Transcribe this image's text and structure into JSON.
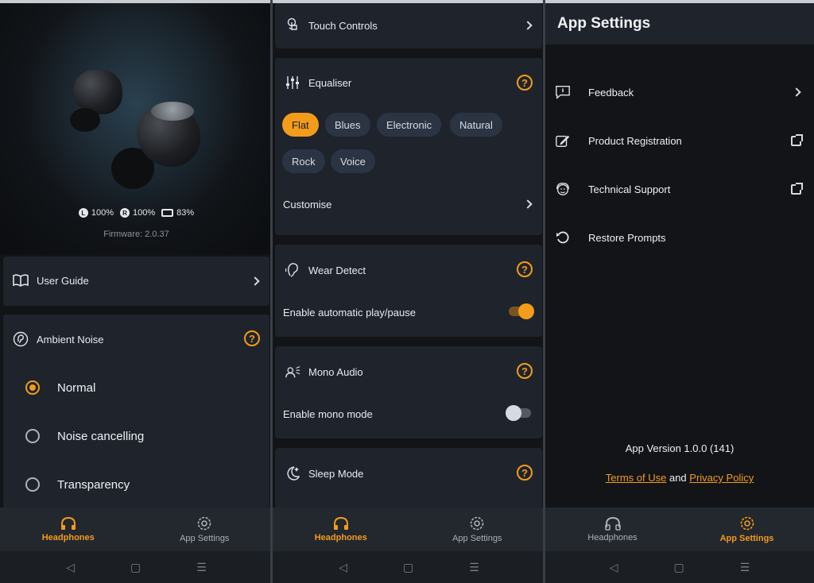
{
  "colors": {
    "accent": "#f39c1b",
    "card": "#1f242c",
    "background": "#121417"
  },
  "panel1": {
    "battery": {
      "left": "100%",
      "right": "100%",
      "case": "83%",
      "left_badge": "L",
      "right_badge": "R"
    },
    "firmware": "Firmware: 2.0.37",
    "user_guide": {
      "label": "User Guide",
      "icon": "book-icon"
    },
    "ambient": {
      "title": "Ambient Noise",
      "icon": "ear-ambient-icon",
      "help": "?",
      "options": [
        {
          "label": "Normal",
          "selected": true
        },
        {
          "label": "Noise cancelling",
          "selected": false
        },
        {
          "label": "Transparency",
          "selected": false
        }
      ]
    }
  },
  "panel2": {
    "touch_controls": {
      "label": "Touch Controls",
      "icon": "touch-icon"
    },
    "equaliser": {
      "title": "Equaliser",
      "icon": "sliders-icon",
      "help": "?",
      "presets": [
        "Flat",
        "Blues",
        "Electronic",
        "Natural",
        "Rock",
        "Voice"
      ],
      "selected": "Flat",
      "customise": "Customise"
    },
    "wear_detect": {
      "title": "Wear Detect",
      "icon": "ear-icon",
      "help": "?",
      "setting": "Enable automatic play/pause",
      "enabled": true
    },
    "mono_audio": {
      "title": "Mono Audio",
      "icon": "mono-icon",
      "help": "?",
      "setting": "Enable mono mode",
      "enabled": false
    },
    "sleep_mode": {
      "title": "Sleep Mode",
      "icon": "moon-icon",
      "help": "?"
    }
  },
  "panel3": {
    "title": "App Settings",
    "items": [
      {
        "label": "Feedback",
        "icon": "feedback-icon",
        "action": "chevron"
      },
      {
        "label": "Product Registration",
        "icon": "edit-icon",
        "action": "external"
      },
      {
        "label": "Technical Support",
        "icon": "support-icon",
        "action": "external"
      },
      {
        "label": "Restore Prompts",
        "icon": "restore-icon",
        "action": "none"
      }
    ],
    "version": "App Version 1.0.0 (141)",
    "terms": "Terms of Use",
    "and": "and",
    "privacy": "Privacy Policy"
  },
  "nav": {
    "headphones": "Headphones",
    "app_settings": "App Settings"
  },
  "sysbar": {
    "back": "◁",
    "home": "▢",
    "menu": "☰"
  }
}
